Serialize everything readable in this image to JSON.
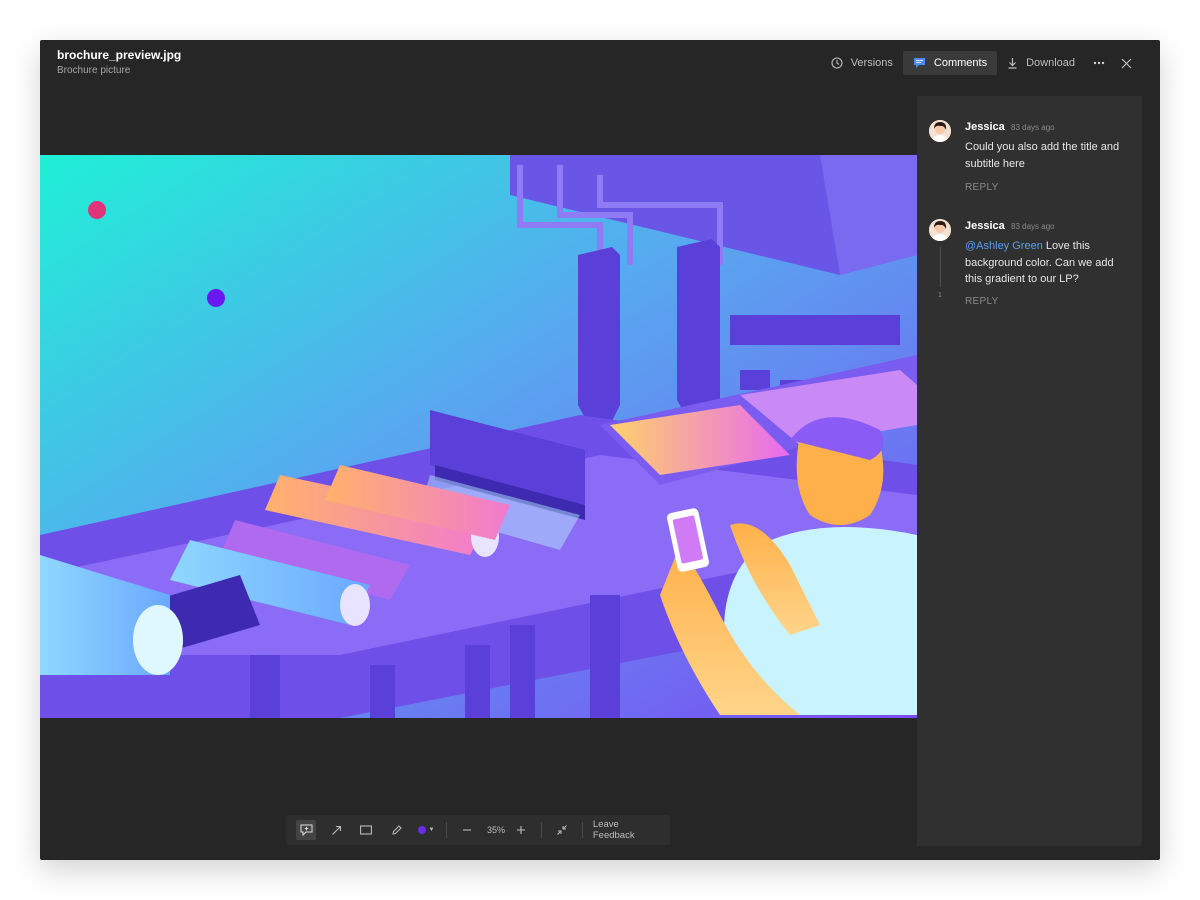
{
  "file": {
    "name": "brochure_preview.jpg",
    "subtitle": "Brochure picture"
  },
  "header": {
    "versions_label": "Versions",
    "comments_label": "Comments",
    "download_label": "Download"
  },
  "comments": [
    {
      "author": "Jessica",
      "time": "83 days ago",
      "text": "Could you also add the title and subtitle here",
      "reply_label": "REPLY"
    },
    {
      "author": "Jessica",
      "time": "83 days ago",
      "mention": "@Ashley Green",
      "text": " Love this background color. Can we add this gradient to our LP?",
      "reply_label": "REPLY",
      "thread_count": "1"
    }
  ],
  "toolbar": {
    "zoom": "35%",
    "feedback_label": "Leave Feedback",
    "tools": [
      "comment-tool-icon",
      "arrow-tool-icon",
      "rectangle-tool-icon",
      "pen-tool-icon",
      "color-picker",
      "zoom-out-icon",
      "zoom-in-icon",
      "fit-screen-icon"
    ]
  },
  "colors": {
    "window_bg": "#262626",
    "panel_bg": "#303030",
    "accent_blue": "#5b9cf2",
    "annotation_color": "#6a2cf0",
    "image_gradient_start": "#1ff0d6",
    "image_gradient_end": "#7b4cf2"
  },
  "image": {
    "alt": "Isometric illustration of a conveyor printing machine with a person holding a phone"
  }
}
